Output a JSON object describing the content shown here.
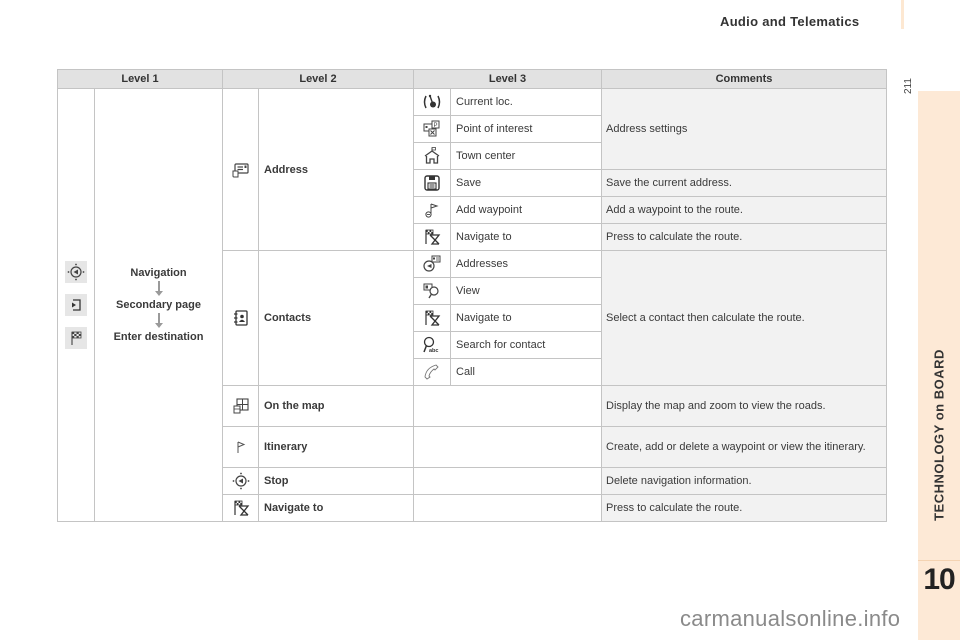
{
  "header": {
    "title": "Audio and Telematics",
    "page_number": "211"
  },
  "side_tab": {
    "label": "TECHNOLOGY on BOARD",
    "chapter": "10"
  },
  "watermark": "carmanualsonline.info",
  "table": {
    "columns": [
      "Level 1",
      "Level 2",
      "Level 3",
      "Comments"
    ],
    "level1": {
      "icons": [
        "navigation-compass-icon",
        "secondary-page-icon",
        "checkered-flag-icon"
      ],
      "path": [
        "Navigation",
        "Secondary page",
        "Enter destination"
      ]
    },
    "groups": [
      {
        "level2": {
          "icon": "address-card-icon",
          "label": "Address"
        },
        "rows": [
          {
            "icon": "current-location-icon",
            "label": "Current loc."
          },
          {
            "icon": "point-of-interest-icon",
            "label": "Point of interest"
          },
          {
            "icon": "town-center-icon",
            "label": "Town center"
          },
          {
            "icon": "save-icon",
            "label": "Save",
            "comment": "Save the current address."
          },
          {
            "icon": "add-waypoint-icon",
            "label": "Add waypoint",
            "comment": "Add a waypoint to the route."
          },
          {
            "icon": "navigate-to-icon",
            "label": "Navigate to",
            "comment": "Press to calculate the route."
          }
        ],
        "shared_comment": "Address settings"
      },
      {
        "level2": {
          "icon": "contacts-icon",
          "label": "Contacts"
        },
        "rows": [
          {
            "icon": "addresses-icon",
            "label": "Addresses"
          },
          {
            "icon": "view-contact-icon",
            "label": "View"
          },
          {
            "icon": "navigate-to-icon",
            "label": "Navigate to"
          },
          {
            "icon": "search-contact-icon",
            "label": "Search for contact"
          },
          {
            "icon": "call-icon",
            "label": "Call"
          }
        ],
        "shared_comment": "Select a contact then calculate the route."
      }
    ],
    "single_rows": [
      {
        "icon": "map-icon",
        "label": "On the map",
        "comment": "Display the map and zoom to view the roads."
      },
      {
        "icon": "itinerary-flag-icon",
        "label": "Itinerary",
        "comment": "Create, add or delete a waypoint or view the itinerary."
      },
      {
        "icon": "stop-navigation-icon",
        "label": "Stop",
        "comment": "Delete navigation information."
      },
      {
        "icon": "navigate-to-icon",
        "label": "Navigate to",
        "comment": "Press to calculate the route."
      }
    ]
  }
}
